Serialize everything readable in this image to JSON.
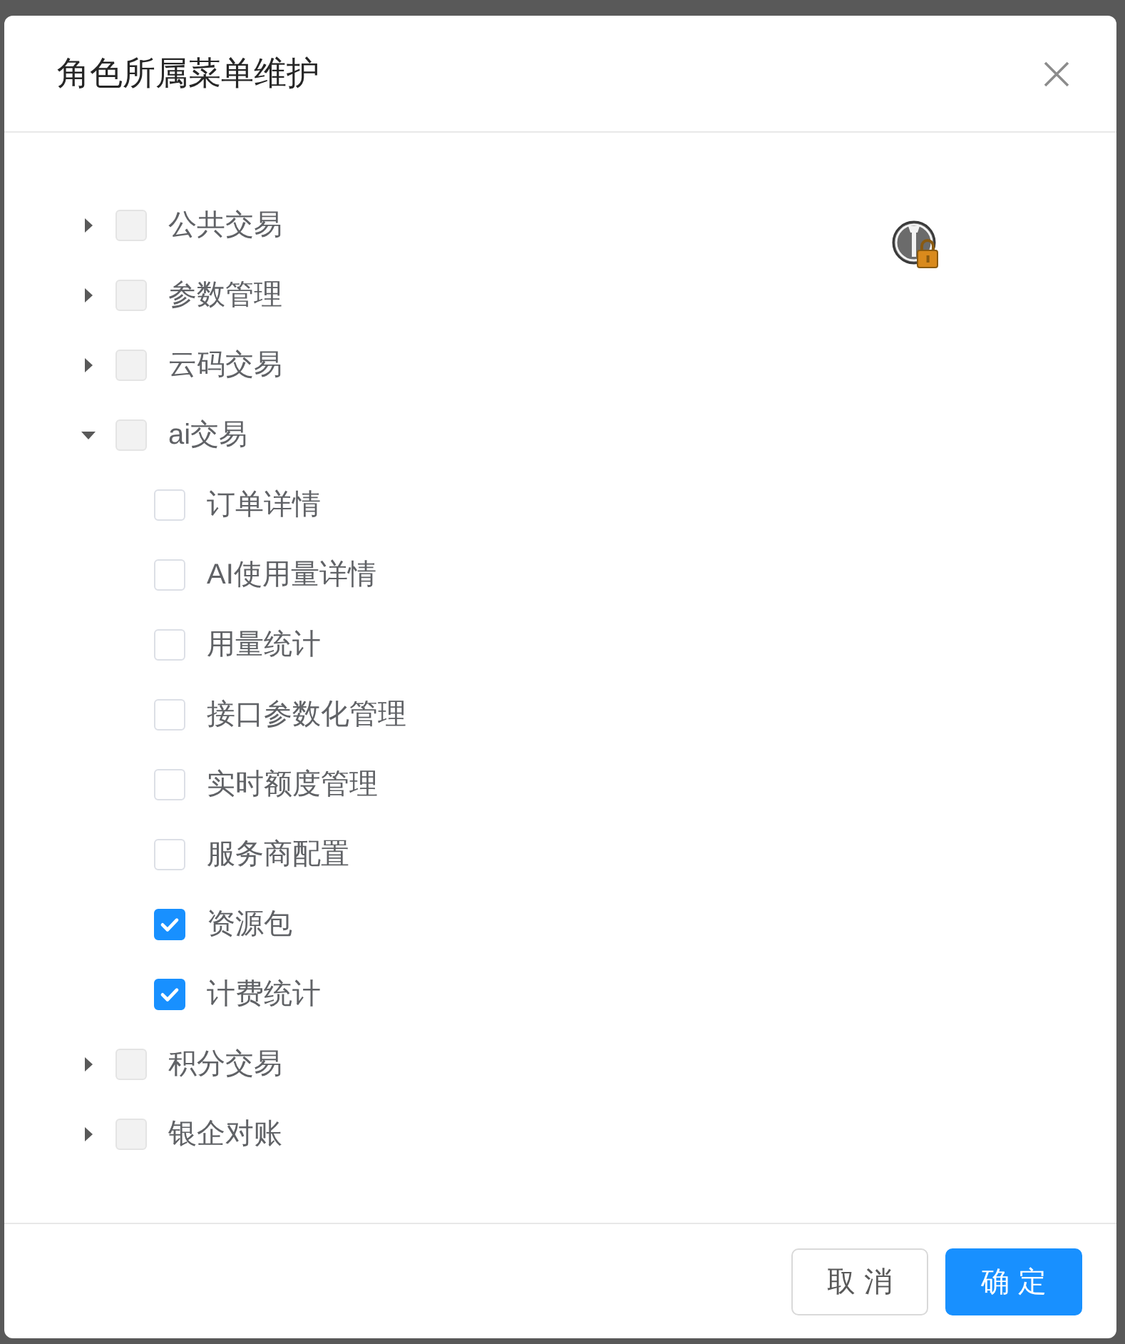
{
  "dialog": {
    "title": "角色所属菜单维护"
  },
  "tree": [
    {
      "label": "公共交易",
      "expanded": false,
      "checked": false,
      "disabled": true
    },
    {
      "label": "参数管理",
      "expanded": false,
      "checked": false,
      "disabled": true
    },
    {
      "label": "云码交易",
      "expanded": false,
      "checked": false,
      "disabled": true
    },
    {
      "label": "ai交易",
      "expanded": true,
      "checked": false,
      "disabled": true,
      "children": [
        {
          "label": "订单详情",
          "checked": false,
          "disabled": false
        },
        {
          "label": "AI使用量详情",
          "checked": false,
          "disabled": false
        },
        {
          "label": "用量统计",
          "checked": false,
          "disabled": false
        },
        {
          "label": "接口参数化管理",
          "checked": false,
          "disabled": false
        },
        {
          "label": "实时额度管理",
          "checked": false,
          "disabled": false
        },
        {
          "label": "服务商配置",
          "checked": false,
          "disabled": false
        },
        {
          "label": "资源包",
          "checked": true,
          "disabled": false
        },
        {
          "label": "计费统计",
          "checked": true,
          "disabled": false
        }
      ]
    },
    {
      "label": "积分交易",
      "expanded": false,
      "checked": false,
      "disabled": true
    },
    {
      "label": "银企对账",
      "expanded": false,
      "checked": false,
      "disabled": true
    }
  ],
  "buttons": [
    {
      "label": "取 消",
      "kind": "default"
    },
    {
      "label": "确 定",
      "kind": "primary"
    }
  ]
}
